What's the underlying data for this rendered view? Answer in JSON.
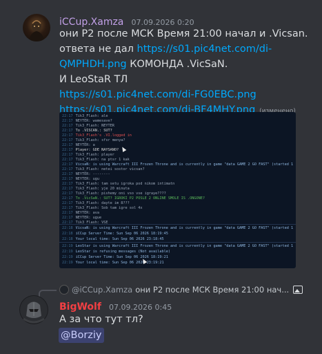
{
  "messages": [
    {
      "author": "iCCup.Xamza",
      "author_color": "#c2a0e8",
      "timestamp": "07.09.2026 0:20",
      "lines": [
        {
          "parts": [
            {
              "text": "они P2 после МСК Время 21:00 начал и .Vicsan."
            }
          ]
        },
        {
          "parts": [
            {
              "text": "ответа не дал "
            },
            {
              "text": "https://s01.pic4net.com/di-",
              "link": true
            }
          ]
        },
        {
          "parts": [
            {
              "text": "QMPHDH.png",
              "link": true
            },
            {
              "text": " КОМОНДА .VicSaN."
            }
          ]
        },
        {
          "parts": [
            {
              "text": "И LeoStaR ТЛ"
            }
          ]
        },
        {
          "parts": [
            {
              "text": "https://s01.pic4net.com/di-FG0EBC.png",
              "link": true
            }
          ]
        },
        {
          "parts": [
            {
              "text": "https://s01.pic4net.com/di-BF4MHY.png",
              "link": true
            },
            {
              "text": " (изменено)",
              "edited": true
            }
          ]
        }
      ]
    },
    {
      "author": "BigWolf",
      "author_color": "#f23f43",
      "timestamp": "07.09.2026 0:45",
      "text": "А за что тут тл?",
      "mention": "@Borziy",
      "reply": {
        "author": "@iCCup.Xamza",
        "text": "они P2 после МСК Время 21:00 нач..."
      }
    }
  ],
  "chat_log": [
    {
      "time": "22:17",
      "text": "Tik3_Flash: ale",
      "color": "#9aa7b8"
    },
    {
      "time": "22:17",
      "text": "NEYTER: wamesave?",
      "color": "#9aa7b8"
    },
    {
      "time": "22:17",
      "text": "Tik3_Flash: NEYTER",
      "color": "#9aa7b8"
    },
    {
      "time": "22:17",
      "text": "To .VISCAN.: SUT?",
      "color": "#d8d8d8"
    },
    {
      "time": "22:17",
      "text": "Tik3_Flash's .VI.logged in",
      "color": "#e05050"
    },
    {
      "time": "22:17",
      "text": "Tik3_Flash: sfsr menya?",
      "color": "#9aa7b8"
    },
    {
      "time": "22:17",
      "text": "NEYTER: a",
      "color": "#9aa7b8"
    },
    {
      "time": "22:17",
      "text": "Player: GDE NAYSANO?",
      "color": "#d8d8d8"
    },
    {
      "time": "22:17",
      "text": "Tik3_Flash: player",
      "color": "#9aa7b8"
    },
    {
      "time": "22:17",
      "text": "Tik3_Flash: na ptsr 1 kak",
      "color": "#9aa7b8"
    },
    {
      "time": "22:17",
      "text": "VicsaN: is using Warcraft III Frozen Throne and is currently in game \"data GAME 2 GO FAST\" (started 13 minutes 8 seconds ago)",
      "color": "#8fb7e0"
    },
    {
      "time": "22:17",
      "text": "Tik3_Flash: netei sostor vicsan?",
      "color": "#9aa7b8"
    },
    {
      "time": "22:17",
      "text": "NEYTER: --------",
      "color": "#9aa7b8"
    },
    {
      "time": "22:17",
      "text": "NEYTER: ugu",
      "color": "#9aa7b8"
    },
    {
      "time": "22:17",
      "text": "Tik3_Flash: tam setu igroka pod nikom intimatn",
      "color": "#9aa7b8"
    },
    {
      "time": "22:17",
      "text": "Tik3_Flash: yje 20 minuta",
      "color": "#9aa7b8"
    },
    {
      "time": "22:17",
      "text": "Tik3_Flash: pishemy oni vso vse igraye????",
      "color": "#9aa7b8"
    },
    {
      "time": "22:17",
      "text": "To .VicSaN.: SUT? IGROKI P2 POSLE 2 ONLINE SMOLE IS .ONGONE?",
      "color": "#5ab85a"
    },
    {
      "time": "22:17",
      "text": "Tik3_Flash: dayte im 8???",
      "color": "#9aa7b8"
    },
    {
      "time": "22:17",
      "text": "Tik3_Flash: Sob tam igre sol 4x",
      "color": "#9aa7b8"
    },
    {
      "time": "22:17",
      "text": "NEYTER: ava",
      "color": "#9aa7b8"
    },
    {
      "time": "22:17",
      "text": "NEYTER: ugue",
      "color": "#9aa7b8"
    },
    {
      "time": "22:17",
      "text": "Tik3_Flash: VSE",
      "color": "#9aa7b8"
    }
  ],
  "chat_log_2": [
    {
      "time": "22:18",
      "text": "VicsaN: is using Warcraft III Frozen Throne and is currently in game \"data GAME 2 GO FAST\" (started 14 minutes 8 seconds ago)",
      "color": "#8fb7e0"
    },
    {
      "time": "22:18",
      "text": "iCCup Server Time: Sun Sep 06 2026 18:19:45",
      "color": "#8fb7e0"
    },
    {
      "time": "22:18",
      "text": "Your local time: Sun Sep 06 2026 23:18:45",
      "color": "#8fb7e0"
    }
  ],
  "chat_log_3": [
    {
      "time": "22:19",
      "text": "LeoStar is using Warcraft III Frozen Throne and is currently in game \"data GAME 2 GO FAST\" (started 14 minutes 43 seconds ago)",
      "color": "#8fb7e0"
    },
    {
      "time": "22:19",
      "text": "LeoStar is refusing messages (Not available)",
      "color": "#8fb7e0"
    },
    {
      "time": "22:19",
      "text": "iCCup Server Time: Sun Sep 06 2026 18:19:21",
      "color": "#8fb7e0"
    },
    {
      "time": "22:19",
      "text": "Your local time: Sun Sep 06 2026 23:19:21",
      "color": "#8fb7e0"
    }
  ],
  "colors": {
    "background": "#313338",
    "link": "#00a8fc",
    "mention_bg": "#3c4270",
    "mention_text": "#c9cdfb"
  },
  "icons": {
    "reply_image": "image-icon",
    "avatar_1": "dark-warrior-avatar",
    "avatar_2": "wolf-helmet-avatar"
  }
}
